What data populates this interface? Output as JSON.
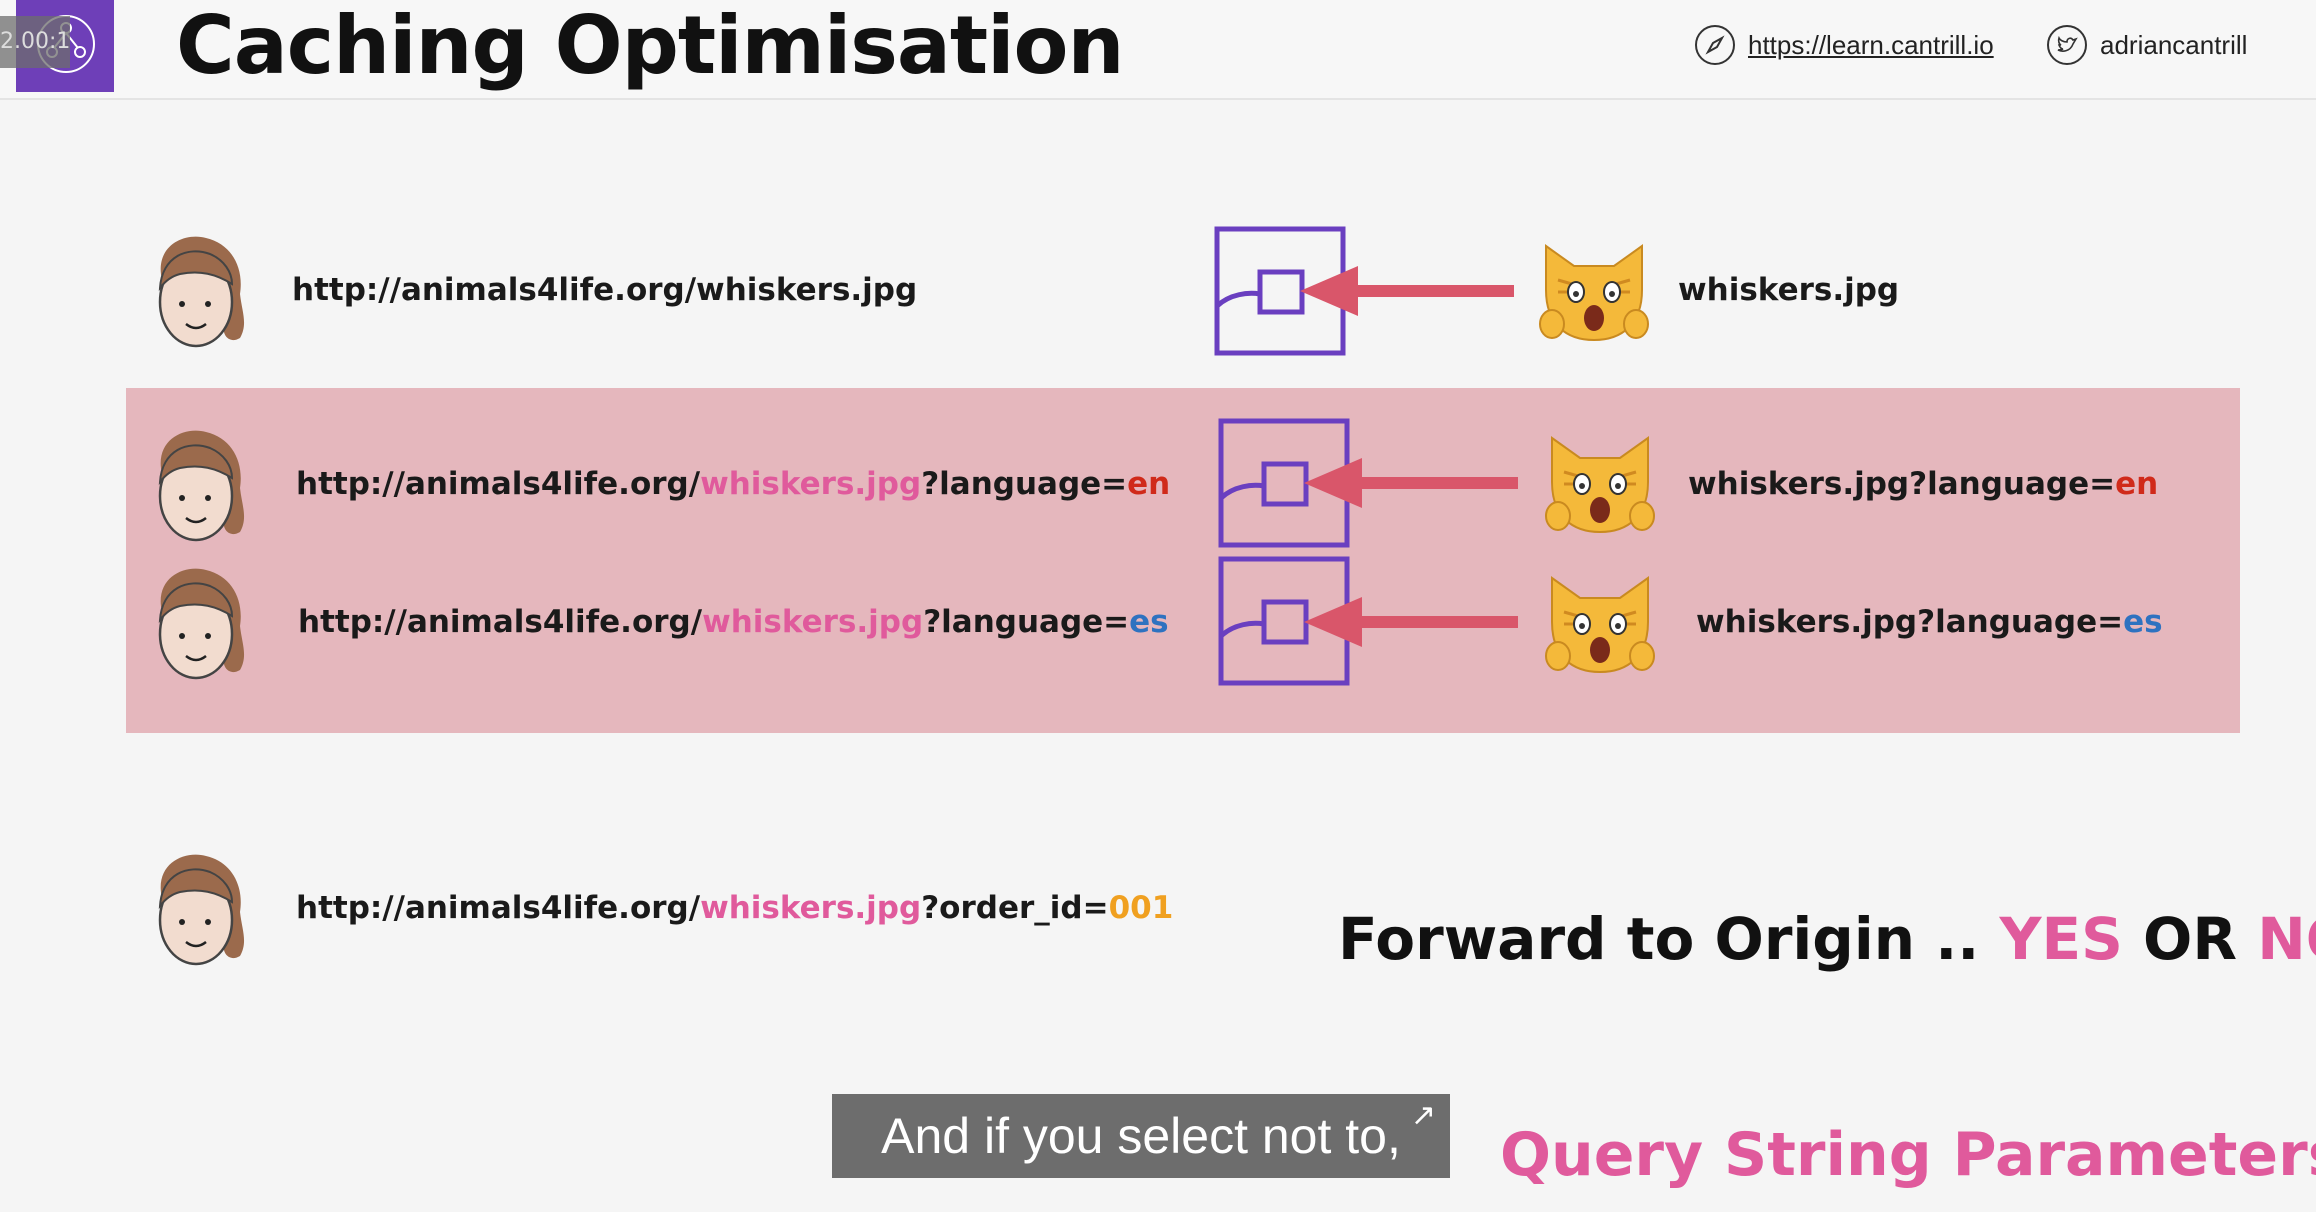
{
  "header": {
    "timecode": "2.00:1",
    "title": "Caching Optimisation",
    "site_link": "https://learn.cantrill.io",
    "twitter_handle": "adriancantrill",
    "icons": [
      "compass-icon",
      "twitter-icon",
      "aws-logo"
    ]
  },
  "rows": [
    {
      "url_base": "http://animals4life.org/whiskers.jpg",
      "object": "whiskers.jpg"
    },
    {
      "url_prefix": "http://animals4life.org/",
      "url_file": "whiskers.jpg",
      "url_query": "?language=",
      "url_value": "en",
      "object_prefix": "whiskers.jpg?language=",
      "object_value": "en"
    },
    {
      "url_prefix": "http://animals4life.org/",
      "url_file": "whiskers.jpg",
      "url_query": "?language=",
      "url_value": "es",
      "object_prefix": "whiskers.jpg?language=",
      "object_value": "es"
    },
    {
      "url_prefix": "http://animals4life.org/",
      "url_file": "whiskers.jpg",
      "url_query": "?order_id=",
      "url_value": "001"
    }
  ],
  "forward": {
    "prefix": "Forward to Origin .. ",
    "yes": "YES",
    "or": " OR ",
    "no": "NO"
  },
  "subtitle": "Query String Parameters",
  "caption": {
    "text": "And if you select not to,",
    "corner": "↗"
  },
  "colors": {
    "accent_pink": "#e05a9c",
    "band": "#e5b7bd",
    "cache_box": "#6a3fc0",
    "arrow": "#d9566a",
    "lang_en": "#d02a1a",
    "lang_es": "#2e72c0",
    "order_value": "#f0a020"
  }
}
